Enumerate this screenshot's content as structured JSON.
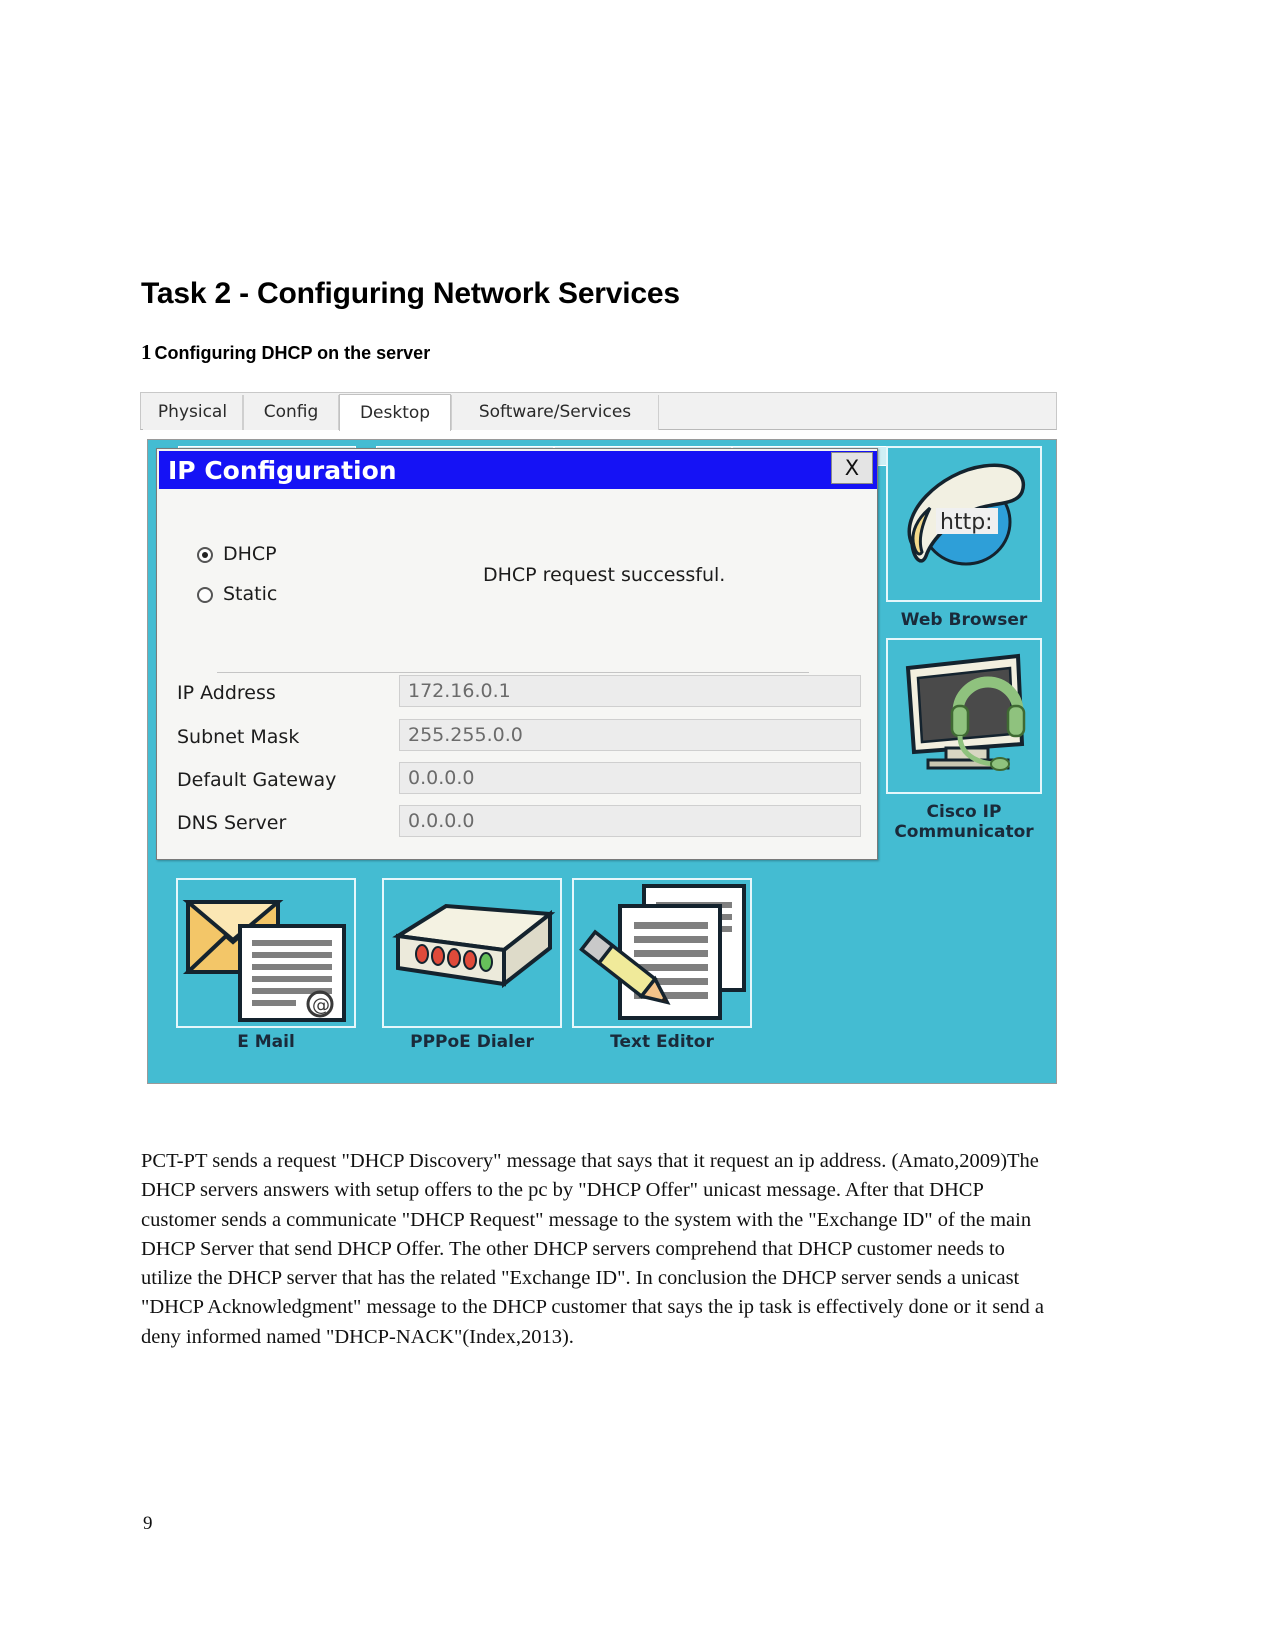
{
  "document": {
    "title": "Task 2 - Configuring Network Services",
    "section_number": "1",
    "section_title": "Configuring DHCP on the server",
    "page_number": "9",
    "paragraph": "PCT-PT sends  a request \"DHCP Discovery\" message that says that it request an ip address. (Amato,2009)The DHCP servers  answers with setup offers to the pc by \"DHCP Offer\" unicast message. After that DHCP customer sends a communicate \"DHCP Request\" message to the system with the \"Exchange ID\" of the main DHCP Server that send DHCP Offer. The other DHCP servers comprehend that DHCP customer needs to utilize the DHCP server that has the related \"Exchange ID\". In conclusion the DHCP server sends a unicast \"DHCP Acknowledgment\" message to the DHCP customer that says the ip task is effectively done or it send a deny informed named \"DHCP-NACK\"(Index,2013)."
  },
  "screenshot": {
    "tabs": [
      {
        "label": "Physical",
        "active": false
      },
      {
        "label": "Config",
        "active": false
      },
      {
        "label": "Desktop",
        "active": true
      },
      {
        "label": "Software/Services",
        "active": false
      }
    ],
    "dialog": {
      "title": "IP Configuration",
      "close_label": "X",
      "status_message": "DHCP request successful.",
      "mode_options": [
        {
          "label": "DHCP",
          "selected": true
        },
        {
          "label": "Static",
          "selected": false
        }
      ],
      "fields": [
        {
          "label": "IP Address",
          "value": "172.16.0.1"
        },
        {
          "label": "Subnet Mask",
          "value": "255.255.0.0"
        },
        {
          "label": "Default Gateway",
          "value": "0.0.0.0"
        },
        {
          "label": "DNS Server",
          "value": "0.0.0.0"
        }
      ]
    },
    "desktop_icons": {
      "right": [
        {
          "label": "Web Browser",
          "icon": "web-browser-icon",
          "badge": "http:"
        },
        {
          "label": "Cisco IP\nCommunicator",
          "icon": "ip-communicator-icon"
        }
      ],
      "right_labels": {
        "web_browser": "Web Browser",
        "cisco_line1": "Cisco IP",
        "cisco_line2": "Communicator"
      },
      "bottom": [
        {
          "label": "E Mail",
          "icon": "email-icon"
        },
        {
          "label": "PPPoE Dialer",
          "icon": "pppoe-dialer-icon"
        },
        {
          "label": "Text Editor",
          "icon": "text-editor-icon"
        }
      ],
      "obscured_label": "Text Editor"
    },
    "colors": {
      "desktop_background": "#44bcd2",
      "titlebar": "#1512f5",
      "dialog_background": "#f6f6f4",
      "field_background": "#ececec"
    }
  }
}
